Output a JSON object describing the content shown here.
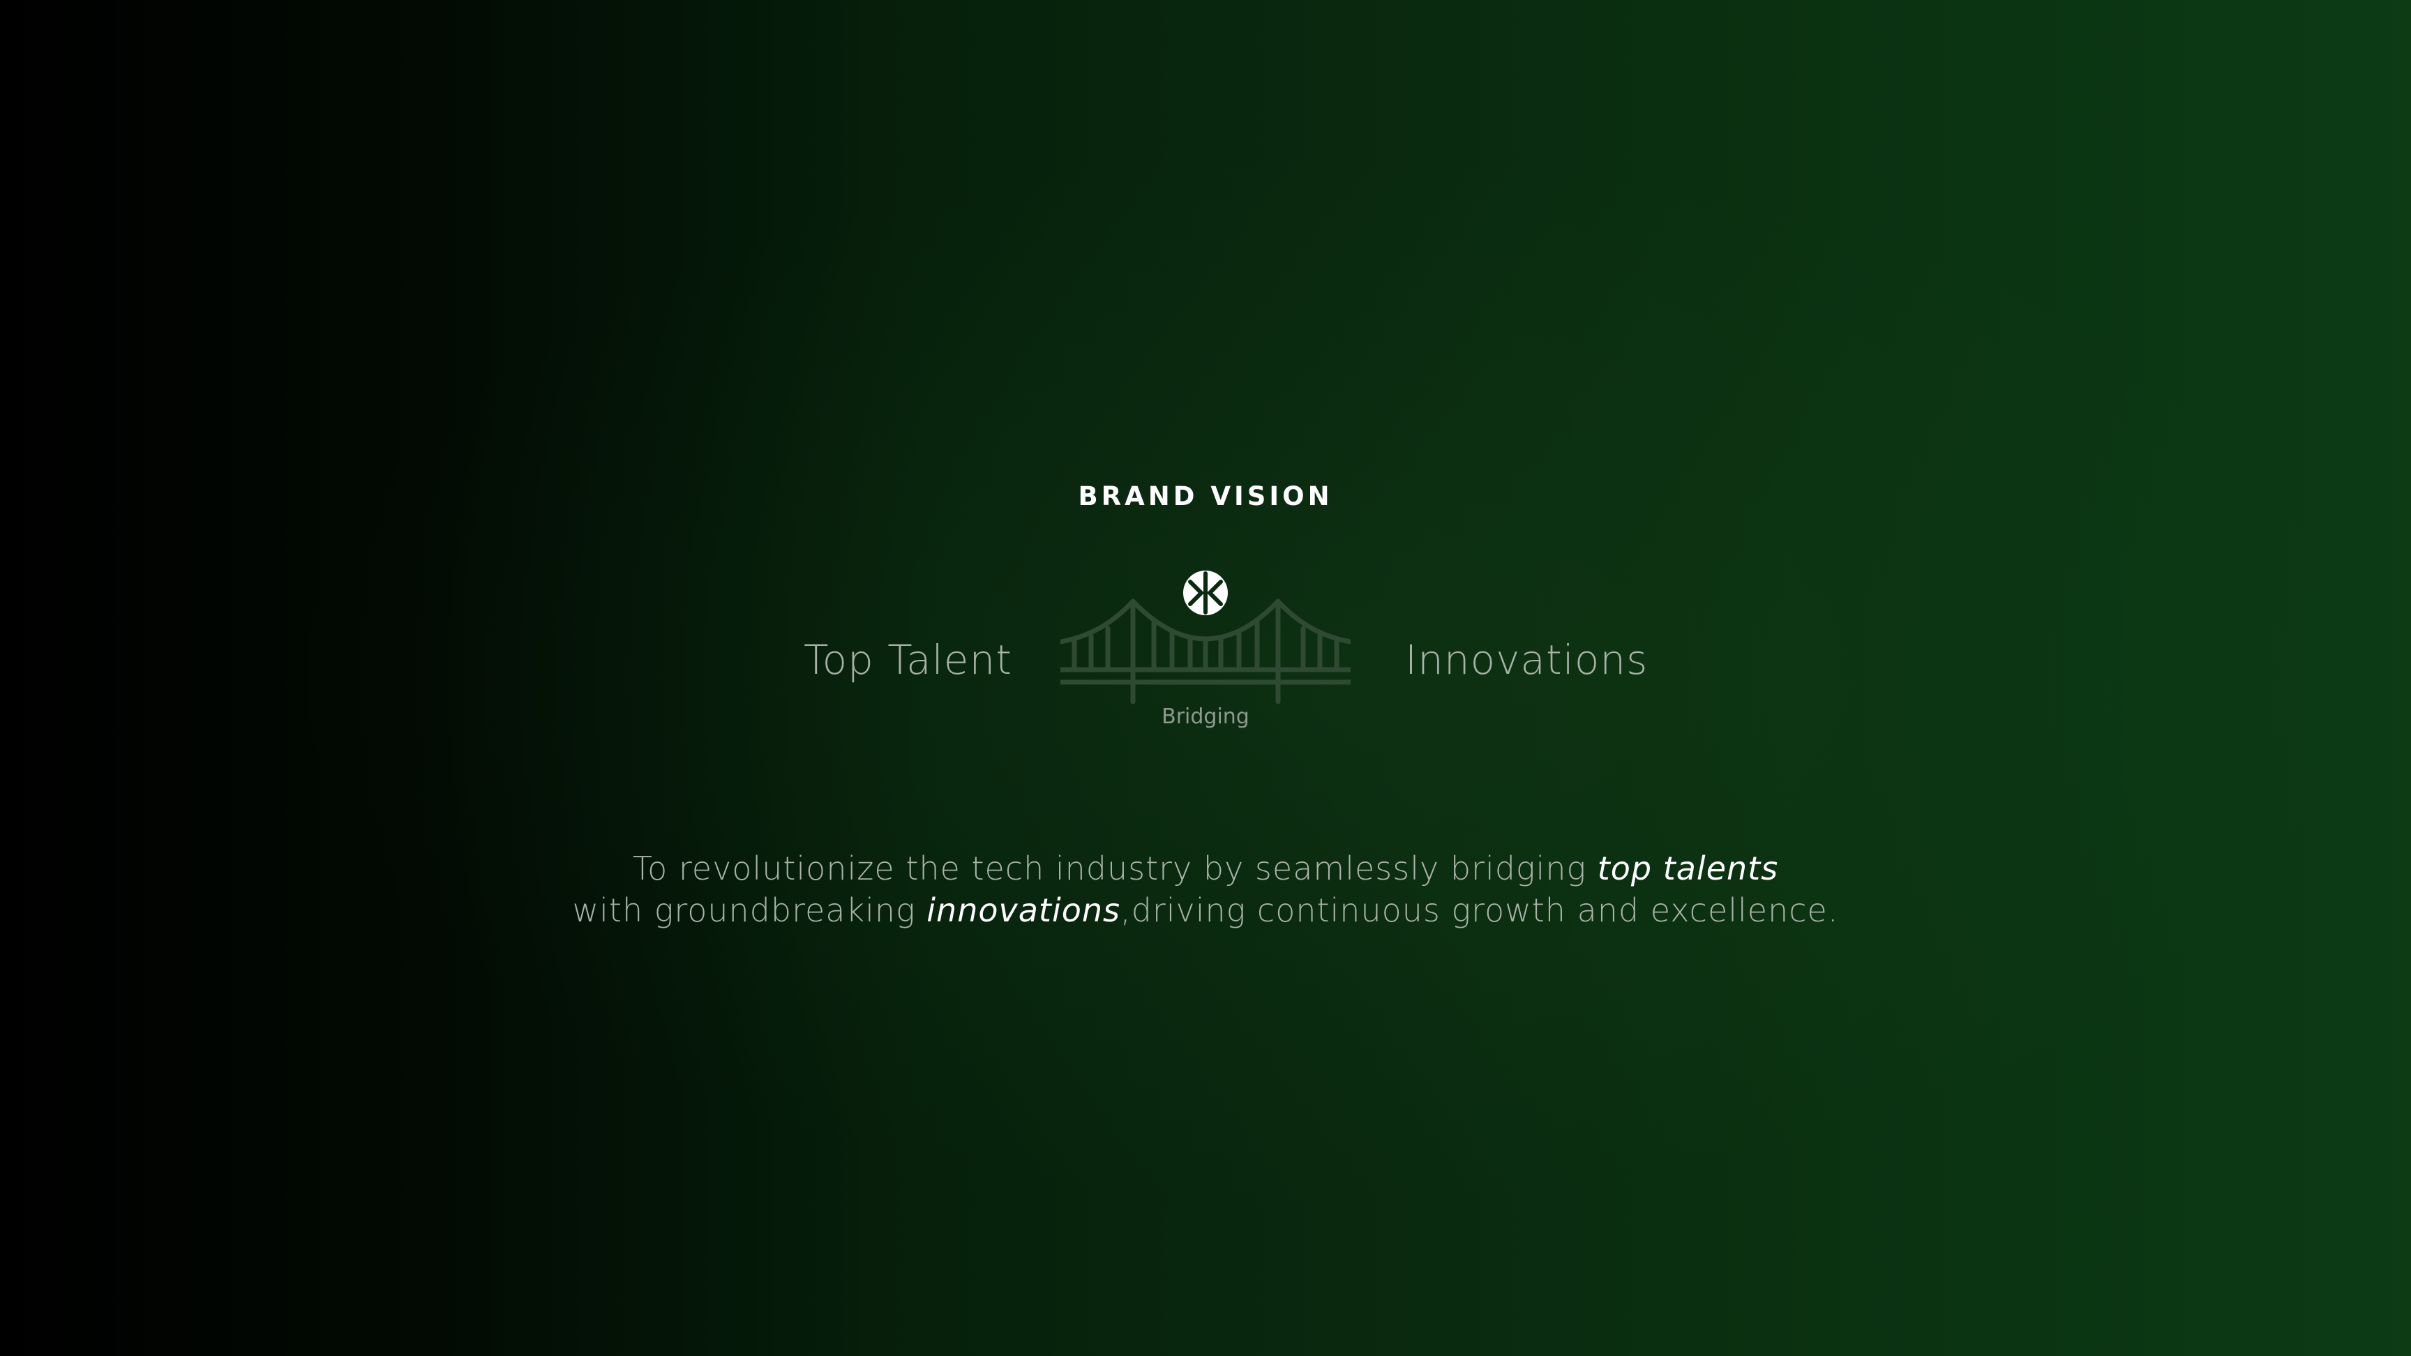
{
  "title": "BRAND VISION",
  "left_label": "Top Talent",
  "right_label": "Innovations",
  "bridge_caption": "Bridging",
  "statement": {
    "line1_prefix": "To revolutionize the tech industry by seamlessly bridging ",
    "line1_emphasis": "top talents",
    "line2_prefix": "with groundbreaking ",
    "line2_emphasis": "innovations",
    "line2_suffix": ",driving continuous growth and excellence."
  },
  "icons": {
    "logo": "brand-logo-icon",
    "bridge": "bridge-icon"
  },
  "colors": {
    "background_left": "#000000",
    "background_right": "#0c3b14",
    "bridge_stroke": "#2f4a32",
    "text_muted": "#a9b4a9",
    "text_white": "#ffffff"
  }
}
